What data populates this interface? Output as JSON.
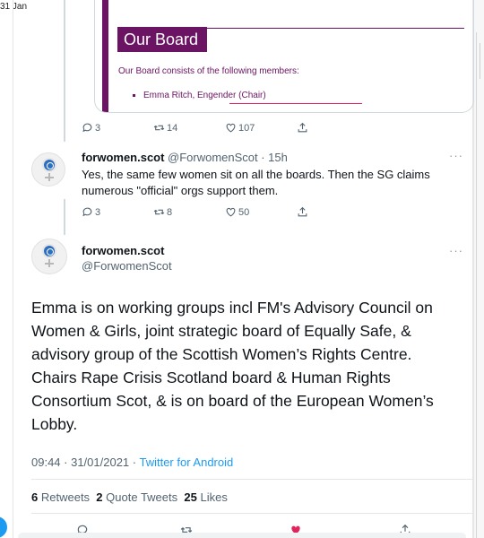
{
  "top_date": "31 Jan",
  "card": {
    "title": "Our Board",
    "text": "Our Board consists of the following members:",
    "member": "Emma Ritch, Engender (Chair)"
  },
  "tweet1_actions": {
    "replies": "3",
    "retweets": "14",
    "likes": "107"
  },
  "tweet2": {
    "name": "forwomen.scot",
    "handle": "@ForwomenScot · 15h",
    "text": "Yes, the same few women sit on all the boards. Then the SG claims numerous \"official\" orgs support them.",
    "replies": "3",
    "retweets": "8",
    "likes": "50"
  },
  "tweet3": {
    "name": "forwomen.scot",
    "handle": "@ForwomenScot",
    "text": "Emma is on working groups incl FM's Advisory Council on Women & Girls, joint strategic board of Equally Safe, & advisory group of the Scottish Women’s Rights Centre. Chairs Rape Crisis Scotland board & Human Rights Consortium Scot, & is on board of the European Women’s Lobby.",
    "time": "09:44 · 31/01/2021 · ",
    "app": "Twitter for Android",
    "retweets_count": "6",
    "retweets_label": "Retweets",
    "quotes_count": "2",
    "quotes_label": "Quote Tweets",
    "likes_count": "25",
    "likes_label": "Likes"
  },
  "more_icon": "more-dots-icon",
  "colors": {
    "accent": "#1d9bf0",
    "card_purple": "#6b1463",
    "like": "#e0245e"
  }
}
